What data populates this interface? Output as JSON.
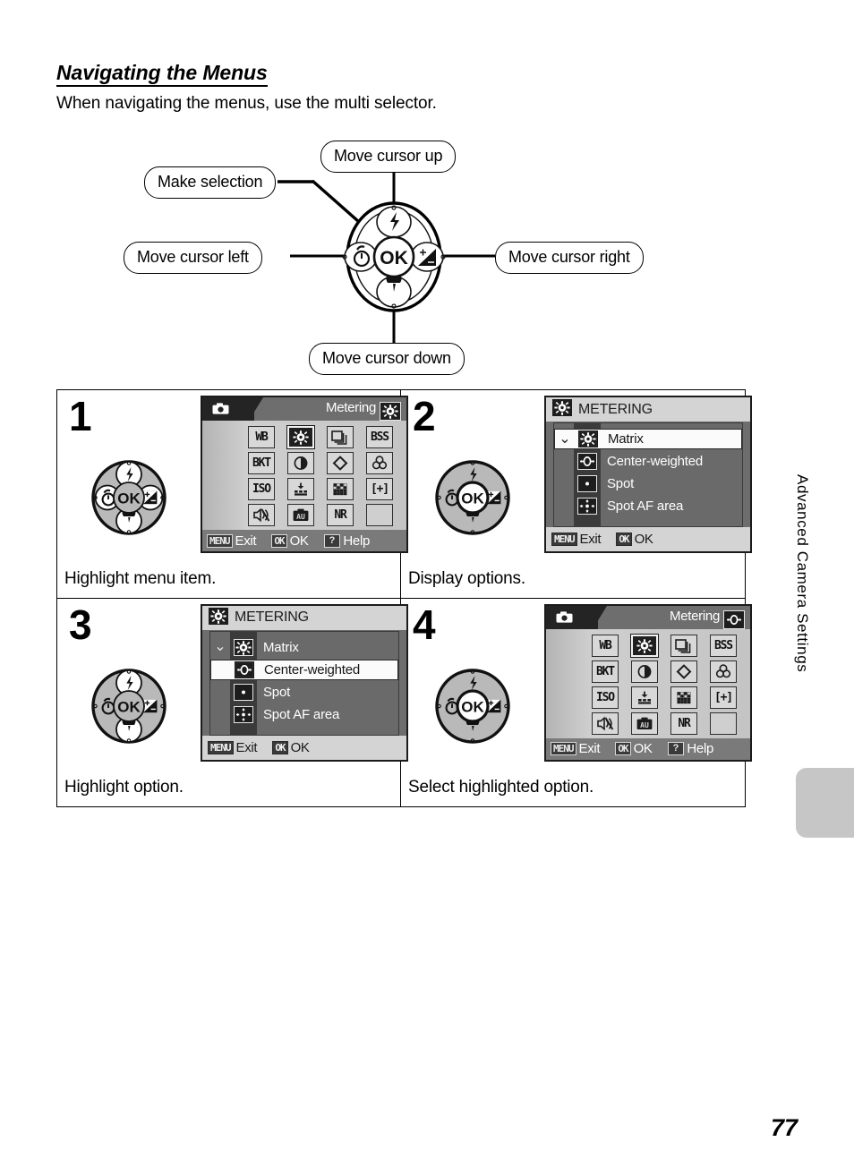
{
  "section": {
    "title": "Navigating the Menus",
    "intro": "When navigating the menus, use the multi selector."
  },
  "diagram": {
    "callout_up": "Move cursor up",
    "callout_selection": "Make selection",
    "callout_left": "Move cursor left",
    "callout_right": "Move cursor right",
    "callout_down": "Move cursor down",
    "dial_center_label": "OK"
  },
  "steps": [
    {
      "number": "1",
      "caption": "Highlight menu item.",
      "screen_type": "grid",
      "title": "Metering",
      "title_icon": "matrix-metering-icon",
      "selected_cell": 1,
      "cells": [
        "WB",
        "matrix-metering-icon",
        "continuous-icon",
        "BSS",
        "BKT",
        "contrast-icon",
        "sharpness-icon",
        "color-options-icon",
        "ISO",
        "saturation-icon",
        "image-adjust-icon",
        "[+]",
        "sound-off-icon",
        "auto-bracket-icon",
        "NR",
        ""
      ],
      "bottom": [
        {
          "key": "MENU",
          "label": "Exit"
        },
        {
          "key": "OK",
          "label": "OK"
        },
        {
          "key": "?",
          "label": "Help"
        }
      ]
    },
    {
      "number": "2",
      "caption": "Display options.",
      "screen_type": "list",
      "title": "METERING",
      "theme": "dark",
      "highlighted": 0,
      "options": [
        {
          "label": "Matrix",
          "icon": "matrix-metering-icon",
          "checked": true
        },
        {
          "label": "Center-weighted",
          "icon": "center-weighted-icon",
          "checked": false
        },
        {
          "label": "Spot",
          "icon": "spot-metering-icon",
          "checked": false
        },
        {
          "label": "Spot AF area",
          "icon": "spot-af-area-icon",
          "checked": false
        }
      ],
      "bottom": [
        {
          "key": "MENU",
          "label": "Exit"
        },
        {
          "key": "OK",
          "label": "OK"
        }
      ]
    },
    {
      "number": "3",
      "caption": "Highlight option.",
      "screen_type": "list",
      "title": "METERING",
      "theme": "dark",
      "highlighted": 1,
      "options": [
        {
          "label": "Matrix",
          "icon": "matrix-metering-icon",
          "checked": true
        },
        {
          "label": "Center-weighted",
          "icon": "center-weighted-icon",
          "checked": false
        },
        {
          "label": "Spot",
          "icon": "spot-metering-icon",
          "checked": false
        },
        {
          "label": "Spot AF area",
          "icon": "spot-af-area-icon",
          "checked": false
        }
      ],
      "bottom": [
        {
          "key": "MENU",
          "label": "Exit"
        },
        {
          "key": "OK",
          "label": "OK"
        }
      ]
    },
    {
      "number": "4",
      "caption": "Select highlighted option.",
      "screen_type": "grid",
      "title": "Metering",
      "title_icon": "center-weighted-icon",
      "selected_cell": 1,
      "cells": [
        "WB",
        "matrix-metering-icon",
        "continuous-icon",
        "BSS",
        "BKT",
        "contrast-icon",
        "sharpness-icon",
        "color-options-icon",
        "ISO",
        "saturation-icon",
        "image-adjust-icon",
        "[+]",
        "sound-off-icon",
        "auto-bracket-icon",
        "NR",
        ""
      ],
      "bottom": [
        {
          "key": "MENU",
          "label": "Exit"
        },
        {
          "key": "OK",
          "label": "OK"
        },
        {
          "key": "?",
          "label": "Help"
        }
      ]
    }
  ],
  "side_tab": {
    "label": "Advanced Camera Settings"
  },
  "page_number": "77"
}
